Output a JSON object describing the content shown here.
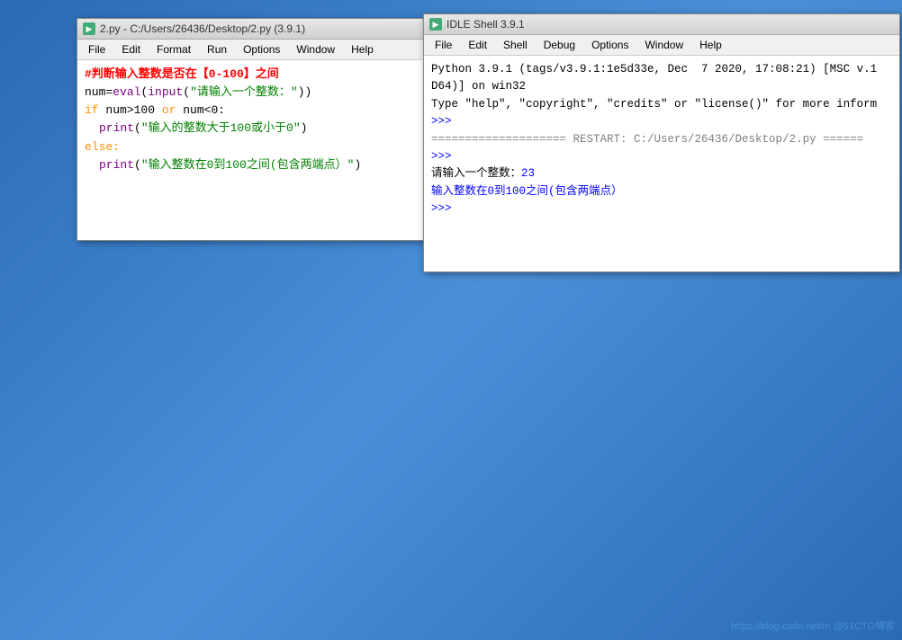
{
  "editor": {
    "title": "2.py - C:/Users/26436/Desktop/2.py (3.9.1)",
    "icon": "▶",
    "menu": [
      "File",
      "Edit",
      "Format",
      "Run",
      "Options",
      "Window",
      "Help"
    ],
    "code_lines": [
      {
        "type": "comment",
        "text": "#判断输入整数是否在【0-100】之间"
      },
      {
        "type": "normal",
        "text": "num=eval(input(\"请输入一个整数：\"))"
      },
      {
        "type": "keyword_line",
        "keyword": "if",
        "rest": " num>100 or num<0:"
      },
      {
        "type": "indent_print",
        "text": "print(\"输入的整数大于100或小于0\")"
      },
      {
        "type": "keyword_else",
        "text": "else:"
      },
      {
        "type": "indent_print2",
        "text": "print(\"输入整数在0到100之间(包含两端点）\")"
      }
    ]
  },
  "shell": {
    "title": "IDLE Shell 3.9.1",
    "icon": "▶",
    "menu": [
      "File",
      "Edit",
      "Shell",
      "Debug",
      "Options",
      "Window",
      "Help"
    ],
    "content": {
      "startup": "Python 3.9.1 (tags/v3.9.1:1e5d33e, Dec  7 2020, 17:08:21) [MSC v.1",
      "startup2": "D64)] on win32",
      "startup3": "Type \"help\", \"copyright\", \"credits\" or \"license()\" for more inform",
      "prompt1": ">>>",
      "restart_line": "==================== RESTART: C:/Users/26436/Desktop/2.py ======",
      "prompt2": ">>>",
      "input_prompt": "请输入一个整数：23",
      "output": "输入整数在0到100之间(包含两端点）",
      "prompt3": ">>>"
    }
  },
  "watermark": "https://blog.csdn.net/m @51CTO博客"
}
